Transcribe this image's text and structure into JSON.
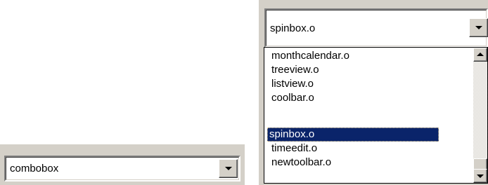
{
  "small_combo": {
    "value": "combobox"
  },
  "open_combo": {
    "value": "spinbox.o",
    "dropdown_items": [
      {
        "label": "monthcalendar.o",
        "selected": false
      },
      {
        "label": "treeview.o",
        "selected": false
      },
      {
        "label": "listview.o",
        "selected": false
      },
      {
        "label": "coolbar.o",
        "selected": false
      },
      {
        "label": "spinbox.o",
        "selected": true
      },
      {
        "label": "timeedit.o",
        "selected": false
      },
      {
        "label": "newtoolbar.o",
        "selected": false
      }
    ]
  },
  "colors": {
    "face": "#d4d0c8",
    "selection": "#0a246a",
    "selection_text": "#ffffff"
  },
  "icons": {
    "dropdown_button": "chevron-down-icon",
    "scroll_up": "scroll-up-arrow-icon",
    "scroll_down": "scroll-down-arrow-icon"
  }
}
